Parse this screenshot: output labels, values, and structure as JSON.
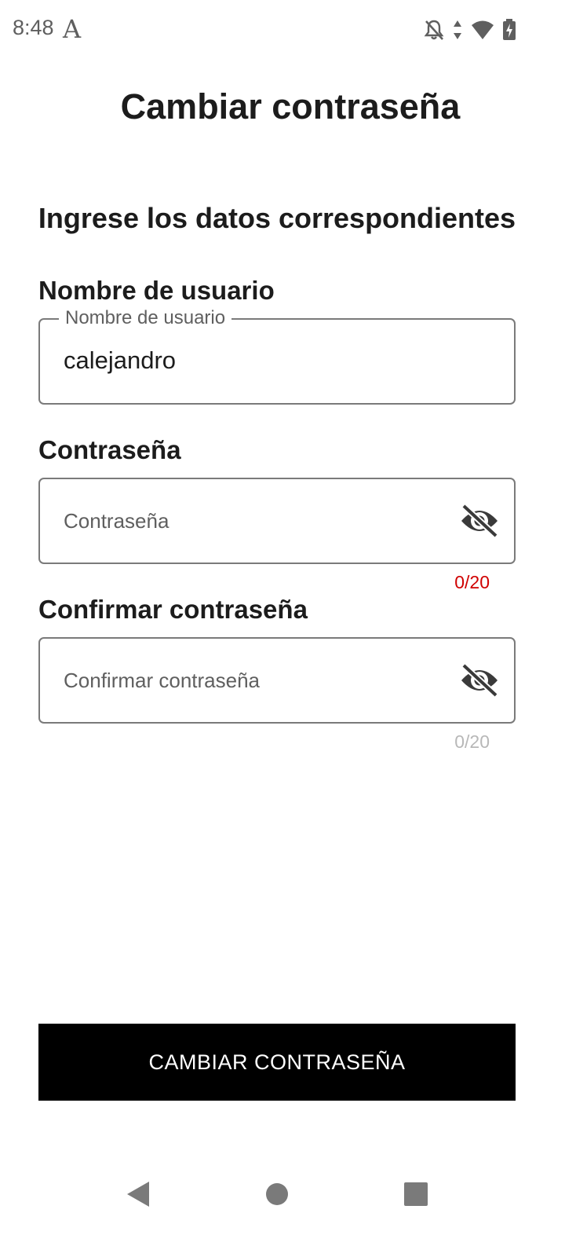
{
  "status_bar": {
    "time": "8:48",
    "app_icon_glyph": "A",
    "icons": [
      "notifications-off-icon",
      "data-arrows-icon",
      "wifi-icon",
      "battery-charging-icon"
    ]
  },
  "page": {
    "title": "Cambiar contraseña",
    "heading": "Ingrese los datos correspondientes"
  },
  "fields": {
    "username": {
      "title": "Nombre de usuario",
      "floating_label": "Nombre de usuario",
      "value": "calejandro"
    },
    "password": {
      "title": "Contraseña",
      "placeholder": "Contraseña",
      "counter": "0/20",
      "counter_color": "#d00000",
      "visibility_icon": "eye-off-icon"
    },
    "confirm_password": {
      "title": "Confirmar contraseña",
      "placeholder": "Confirmar contraseña",
      "counter": "0/20",
      "counter_color": "#b8b8b8",
      "visibility_icon": "eye-off-icon"
    }
  },
  "submit": {
    "label": "CAMBIAR CONTRASEÑA",
    "background": "#000000",
    "text_color": "#ffffff"
  },
  "nav_bar": {
    "buttons": [
      "back-icon",
      "home-icon",
      "recents-icon"
    ]
  }
}
